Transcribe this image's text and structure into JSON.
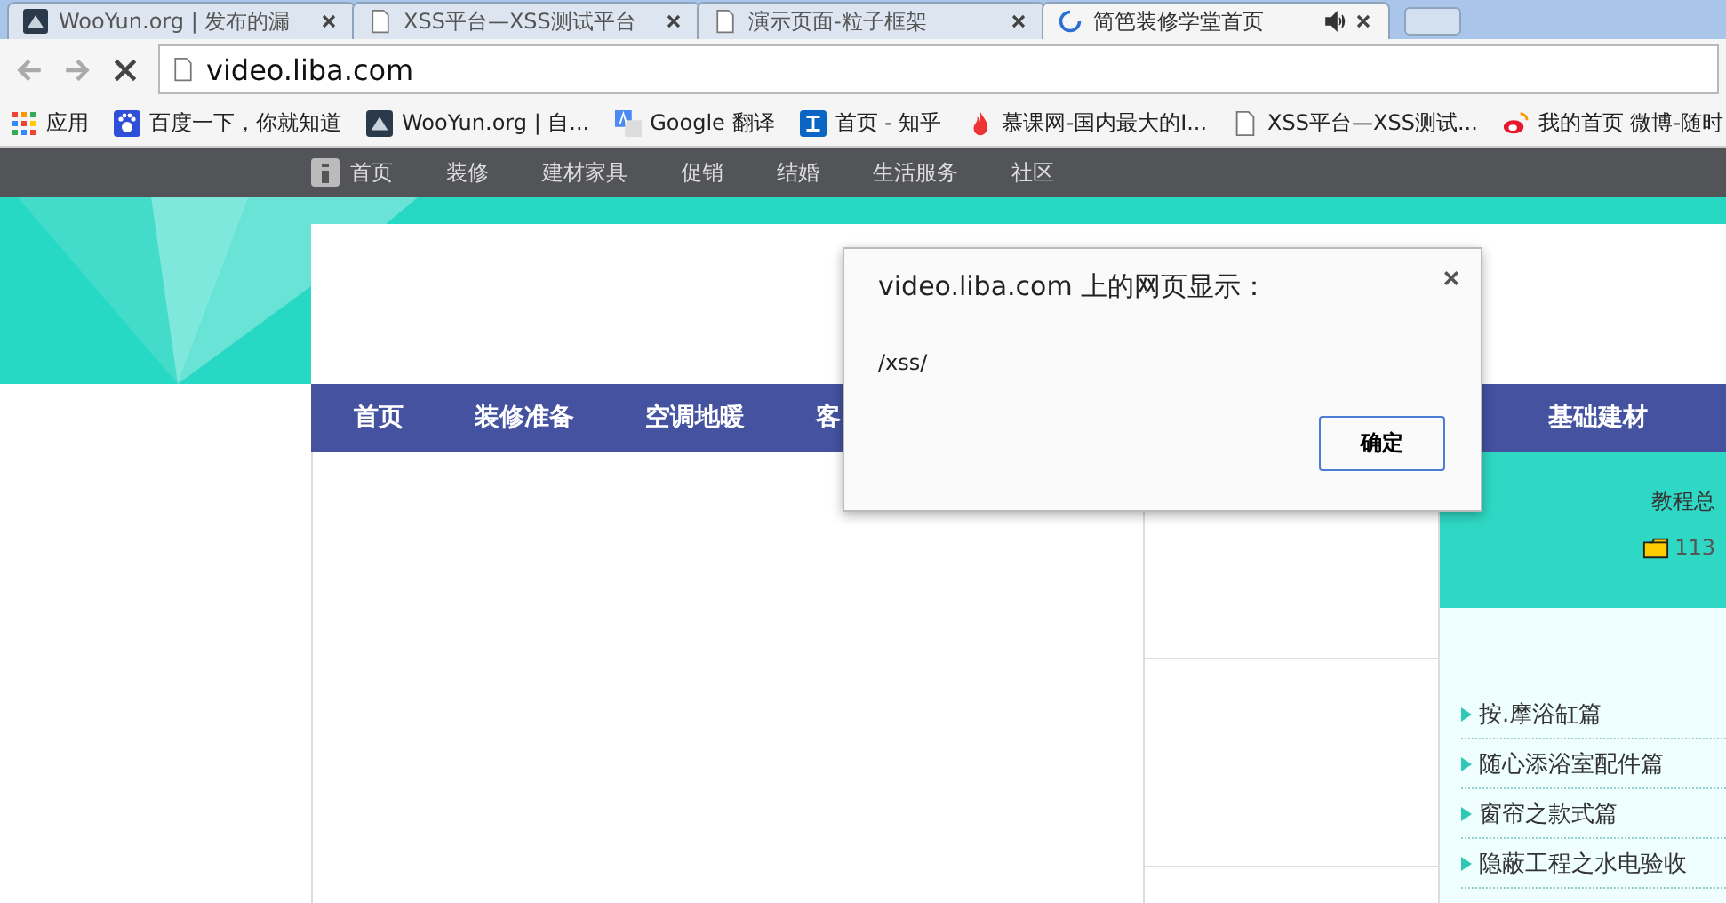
{
  "browser": {
    "tabs": [
      {
        "title": "WooYun.org | 发布的漏",
        "kind": "wooyun",
        "selected": false
      },
      {
        "title": "XSS平台—XSS测试平台",
        "kind": "page",
        "selected": false
      },
      {
        "title": "演示页面-粒子框架",
        "kind": "page",
        "selected": false
      },
      {
        "title": "简笆装修学堂首页",
        "kind": "loading",
        "selected": true,
        "audio": true
      }
    ],
    "url": "video.liba.com",
    "loading": true,
    "bookmarks": [
      {
        "label": "应用",
        "kind": "apps"
      },
      {
        "label": "百度一下，你就知道",
        "kind": "paw"
      },
      {
        "label": "WooYun.org | 自...",
        "kind": "wooyun"
      },
      {
        "label": "Google 翻译",
        "kind": "translate"
      },
      {
        "label": "首页 - 知乎",
        "kind": "zhihu"
      },
      {
        "label": "慕课网-国内最大的I...",
        "kind": "flame"
      },
      {
        "label": "XSS平台—XSS测试...",
        "kind": "page"
      },
      {
        "label": "我的首页 微博-随时",
        "kind": "weibo"
      }
    ]
  },
  "site": {
    "top_nav": [
      "首页",
      "装修",
      "建材家具",
      "促销",
      "结婚",
      "生活服务",
      "社区"
    ],
    "main_nav_left": [
      "首页",
      "装修准备",
      "空调地暖",
      "客"
    ],
    "main_nav_right": [
      "基础建材"
    ],
    "stats_label": "教程总",
    "count": "113",
    "links": [
      "按.摩浴缸篇",
      "随心添浴室配件篇",
      "窗帘之款式篇",
      "隐蔽工程之水电验收"
    ]
  },
  "dialog": {
    "title": "video.liba.com 上的网页显示：",
    "message": "/xss/",
    "button": "确定"
  }
}
